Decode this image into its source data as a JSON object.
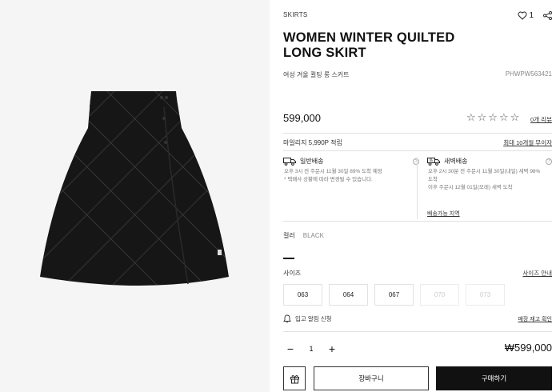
{
  "product": {
    "category": "SKIRTS",
    "title": "WOMEN WINTER QUILTED LONG SKIRT",
    "korean_name": "여성 겨울 퀼팅 롱 스커트",
    "sku": "PHWPW563421",
    "price": "599,000",
    "like_count": "1",
    "rating_stars": "☆☆☆☆☆",
    "review_link": "0개 리뷰",
    "image_icon": "black-quilted-skirt"
  },
  "mileage": {
    "text": "마일리지 5,990P 적립",
    "installment_link": "최대 10개월 무이자"
  },
  "shipping": {
    "standard": {
      "title": "일반배송",
      "line1": "오후 3시 전 주문시 11월 30일 89% 도착 예정",
      "line2": "* 택배사 상황에 따라 변경될 수 있습니다."
    },
    "dawn": {
      "title": "새벽배송",
      "line1": "오후 2시 30분 전 주문시 11월 30일(내일) 새벽 98%",
      "line2": "도착",
      "line3": "이후 주문시 12월 01일(모레) 새벽 도착"
    },
    "area_link": "배송가능 지역"
  },
  "color": {
    "label": "컬러",
    "value": "BLACK"
  },
  "size": {
    "label": "사이즈",
    "guide_link": "사이즈 안내",
    "options": [
      {
        "label": "063",
        "available": true
      },
      {
        "label": "064",
        "available": true
      },
      {
        "label": "067",
        "available": true
      },
      {
        "label": "070",
        "available": false
      },
      {
        "label": "073",
        "available": false
      }
    ]
  },
  "restock": {
    "label": "입고 알림 신청",
    "status_link": "매장 재고 확인"
  },
  "quantity": {
    "minus": "−",
    "value": "1",
    "plus": "+"
  },
  "total": "₩599,000",
  "buttons": {
    "cart": "장바구니",
    "buy": "구매하기"
  },
  "colors": {
    "accent": "#111111",
    "gallery_bg": "#f5f5f5"
  }
}
